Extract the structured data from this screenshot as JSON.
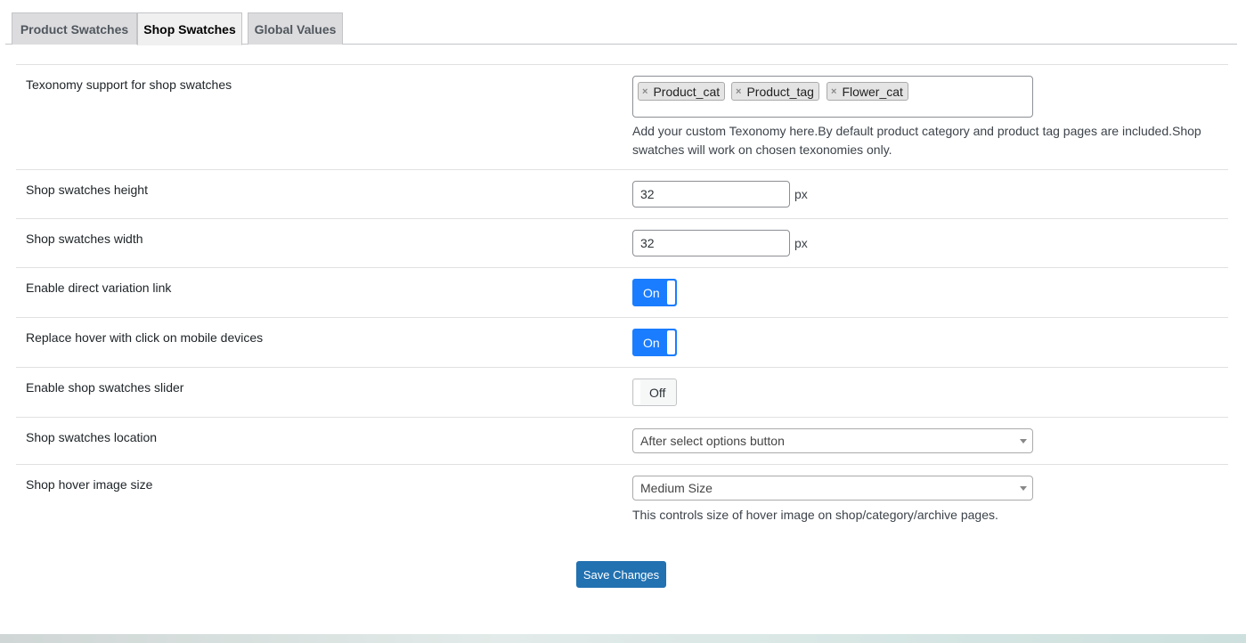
{
  "tabs": [
    {
      "label": "Product Swatches",
      "active": false
    },
    {
      "label": "Shop Swatches",
      "active": true
    },
    {
      "label": "Global Values",
      "active": false
    }
  ],
  "settings": {
    "taxonomy": {
      "label": "Texonomy support for shop swatches",
      "tags": [
        "Product_cat",
        "Product_tag",
        "Flower_cat"
      ],
      "remove_glyph": "×",
      "description": "Add your custom Texonomy here.By default product category and product tag pages are included.Shop swatches will work on chosen texonomies only."
    },
    "height": {
      "label": "Shop swatches height",
      "value": "32",
      "unit": "px"
    },
    "width": {
      "label": "Shop swatches width",
      "value": "32",
      "unit": "px"
    },
    "direct_link": {
      "label": "Enable direct variation link",
      "state": "On"
    },
    "hover_click": {
      "label": "Replace hover with click on mobile devices",
      "state": "On"
    },
    "slider": {
      "label": "Enable shop swatches slider",
      "state": "Off"
    },
    "location": {
      "label": "Shop swatches location",
      "selected": "After select options button"
    },
    "hover_size": {
      "label": "Shop hover image size",
      "selected": "Medium Size",
      "description": "This controls size of hover image on shop/category/archive pages."
    }
  },
  "save_label": "Save Changes",
  "colors": {
    "toggle_on": "#1a7dff",
    "primary_button": "#2271b1"
  }
}
